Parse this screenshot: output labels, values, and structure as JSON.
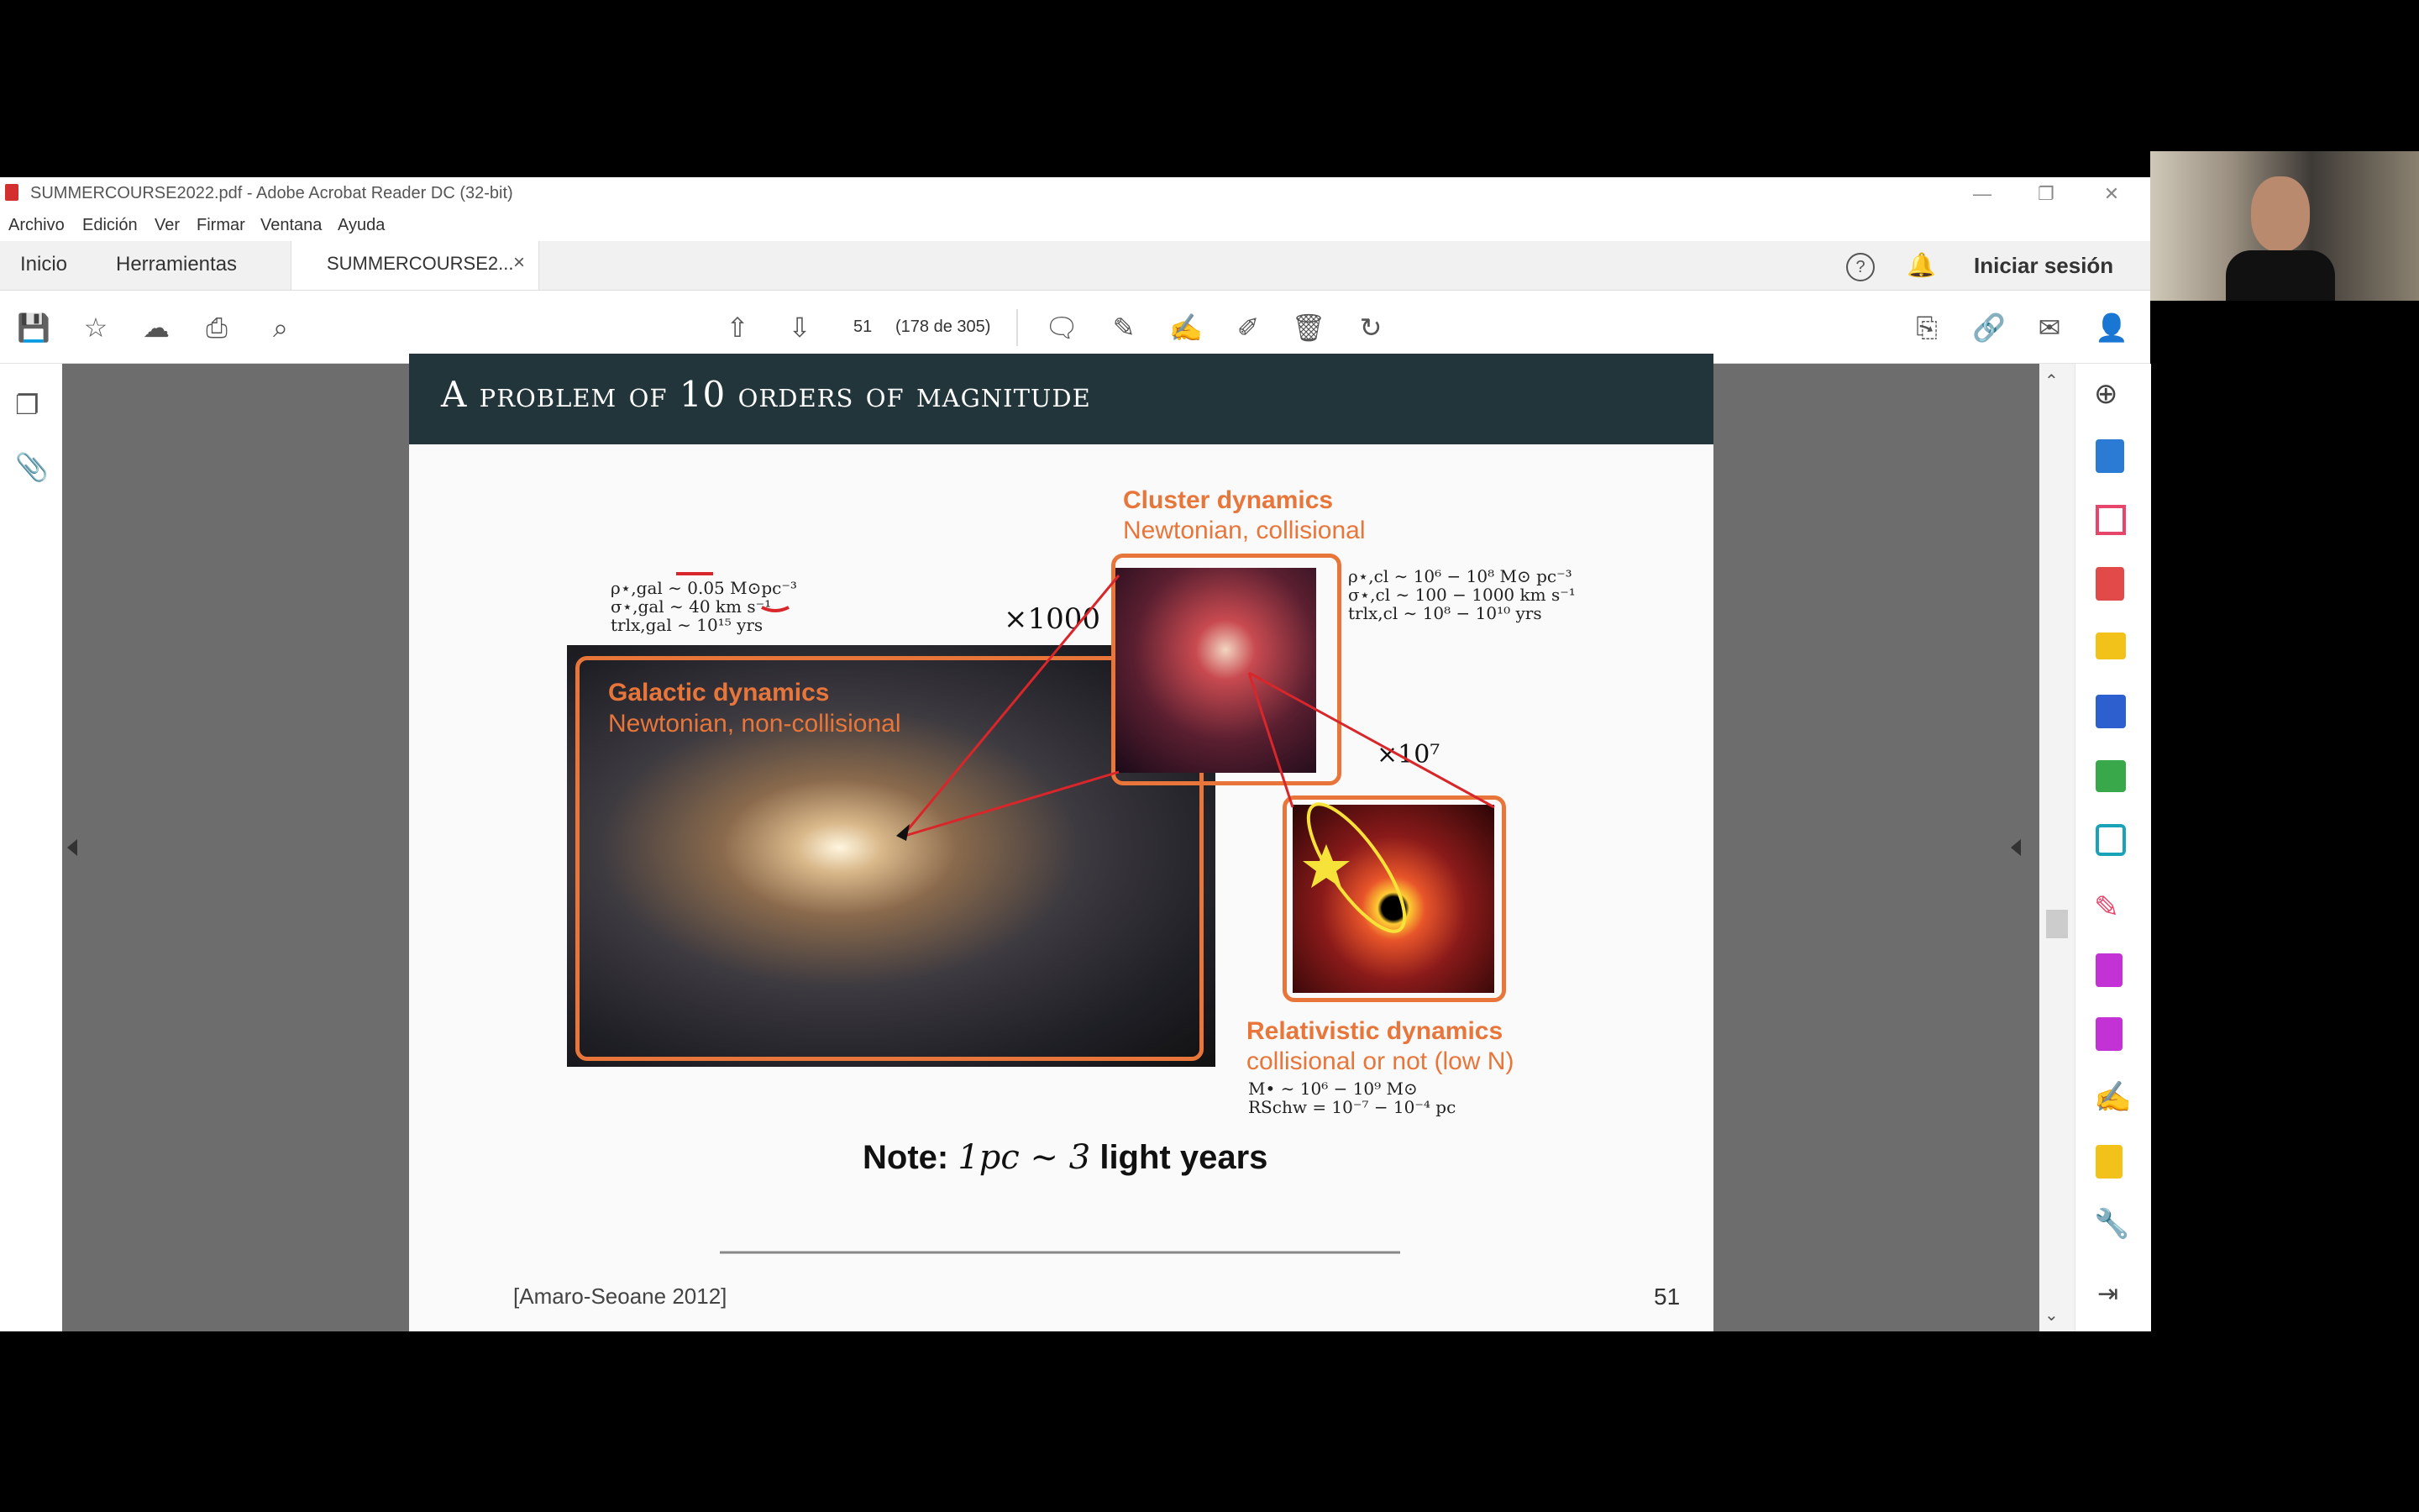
{
  "window": {
    "title": "SUMMERCOURSE2022.pdf - Adobe Acrobat Reader DC (32-bit)",
    "controls": {
      "minimize": "—",
      "restore": "❐",
      "close": "✕"
    }
  },
  "menu": [
    "Archivo",
    "Edición",
    "Ver",
    "Firmar",
    "Ventana",
    "Ayuda"
  ],
  "tabs": {
    "home": "Inicio",
    "tools": "Herramientas",
    "document": "SUMMERCOURSE2...",
    "close": "×",
    "signin": "Iniciar sesión"
  },
  "toolbar": {
    "page_current": "51",
    "page_total": "(178 de 305)"
  },
  "slide": {
    "title": "A problem of 10 orders of magnitude",
    "galactic": {
      "title": "Galactic dynamics",
      "subtitle": "Newtonian, non-collisional"
    },
    "cluster": {
      "title": "Cluster dynamics",
      "subtitle": "Newtonian, collisional"
    },
    "relativistic": {
      "title": "Relativistic dynamics",
      "subtitle": "collisional or not (low N)"
    },
    "factor_1000": "×1000",
    "factor_1e7": "×10⁷",
    "gal_formulas": [
      "ρ⋆,gal ∼ 0.05 M⊙pc⁻³",
      "σ⋆,gal ∼ 40 km s⁻¹",
      "trlx,gal ∼ 10¹⁵ yrs"
    ],
    "cl_formulas": [
      "ρ⋆,cl ∼ 10⁶ − 10⁸ M⊙ pc⁻³",
      "σ⋆,cl ∼ 100 − 1000 km s⁻¹",
      "trlx,cl ∼ 10⁸ − 10¹⁰ yrs"
    ],
    "bh_formulas": [
      "M• ∼ 10⁶ − 10⁹ M⊙",
      "RSchw = 10⁻⁷ − 10⁻⁴ pc"
    ],
    "note_bold": "Note:",
    "note_math": "1pc ∼ 3",
    "note_rest": "light years",
    "citation": "[Amaro-Seoane 2012]",
    "page_number": "51"
  }
}
